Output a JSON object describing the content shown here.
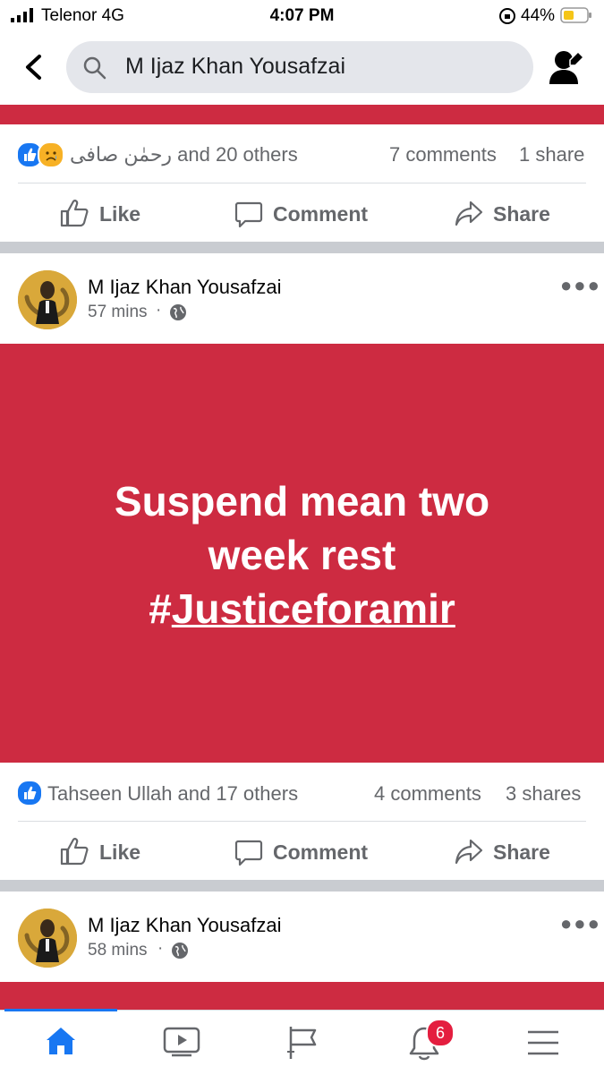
{
  "status_bar": {
    "carrier": "Telenor  4G",
    "time": "4:07 PM",
    "battery": "44%"
  },
  "search": {
    "query": "M Ijaz Khan Yousafzai"
  },
  "post1": {
    "reactions": "رحمٰن صافی and 20 others",
    "comments": "7 comments",
    "shares": "1 share"
  },
  "actions": {
    "like": "Like",
    "comment": "Comment",
    "share": "Share"
  },
  "post2": {
    "author": "M Ijaz Khan Yousafzai",
    "time": "57 mins",
    "image_text_line1": "Suspend mean two",
    "image_text_line2": "week rest",
    "image_hashtag": "#Justiceforamir",
    "reactions": "Tahseen Ullah and 17 others",
    "comments": "4 comments",
    "shares": "3 shares"
  },
  "post3": {
    "author": "M Ijaz Khan Yousafzai",
    "time": "58 mins"
  },
  "bottom_nav": {
    "notifications_badge": "6"
  },
  "colors": {
    "accent": "#1877f2",
    "post_background": "#cd2b41",
    "badge": "#e41e3f"
  }
}
